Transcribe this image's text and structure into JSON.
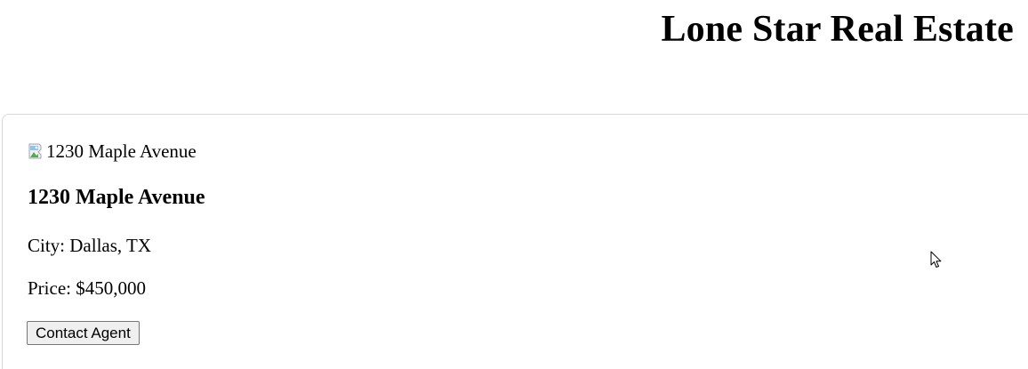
{
  "header": {
    "title": "Lone Star Real Estate"
  },
  "listing": {
    "image_alt": "1230 Maple Avenue",
    "image_icon": "broken-image-icon",
    "address": "1230 Maple Avenue",
    "city_text": "City: Dallas, TX",
    "price_text": "Price: $450,000",
    "contact_label": "Contact Agent"
  },
  "cursor": {
    "icon": "arrow-pointer-icon"
  }
}
